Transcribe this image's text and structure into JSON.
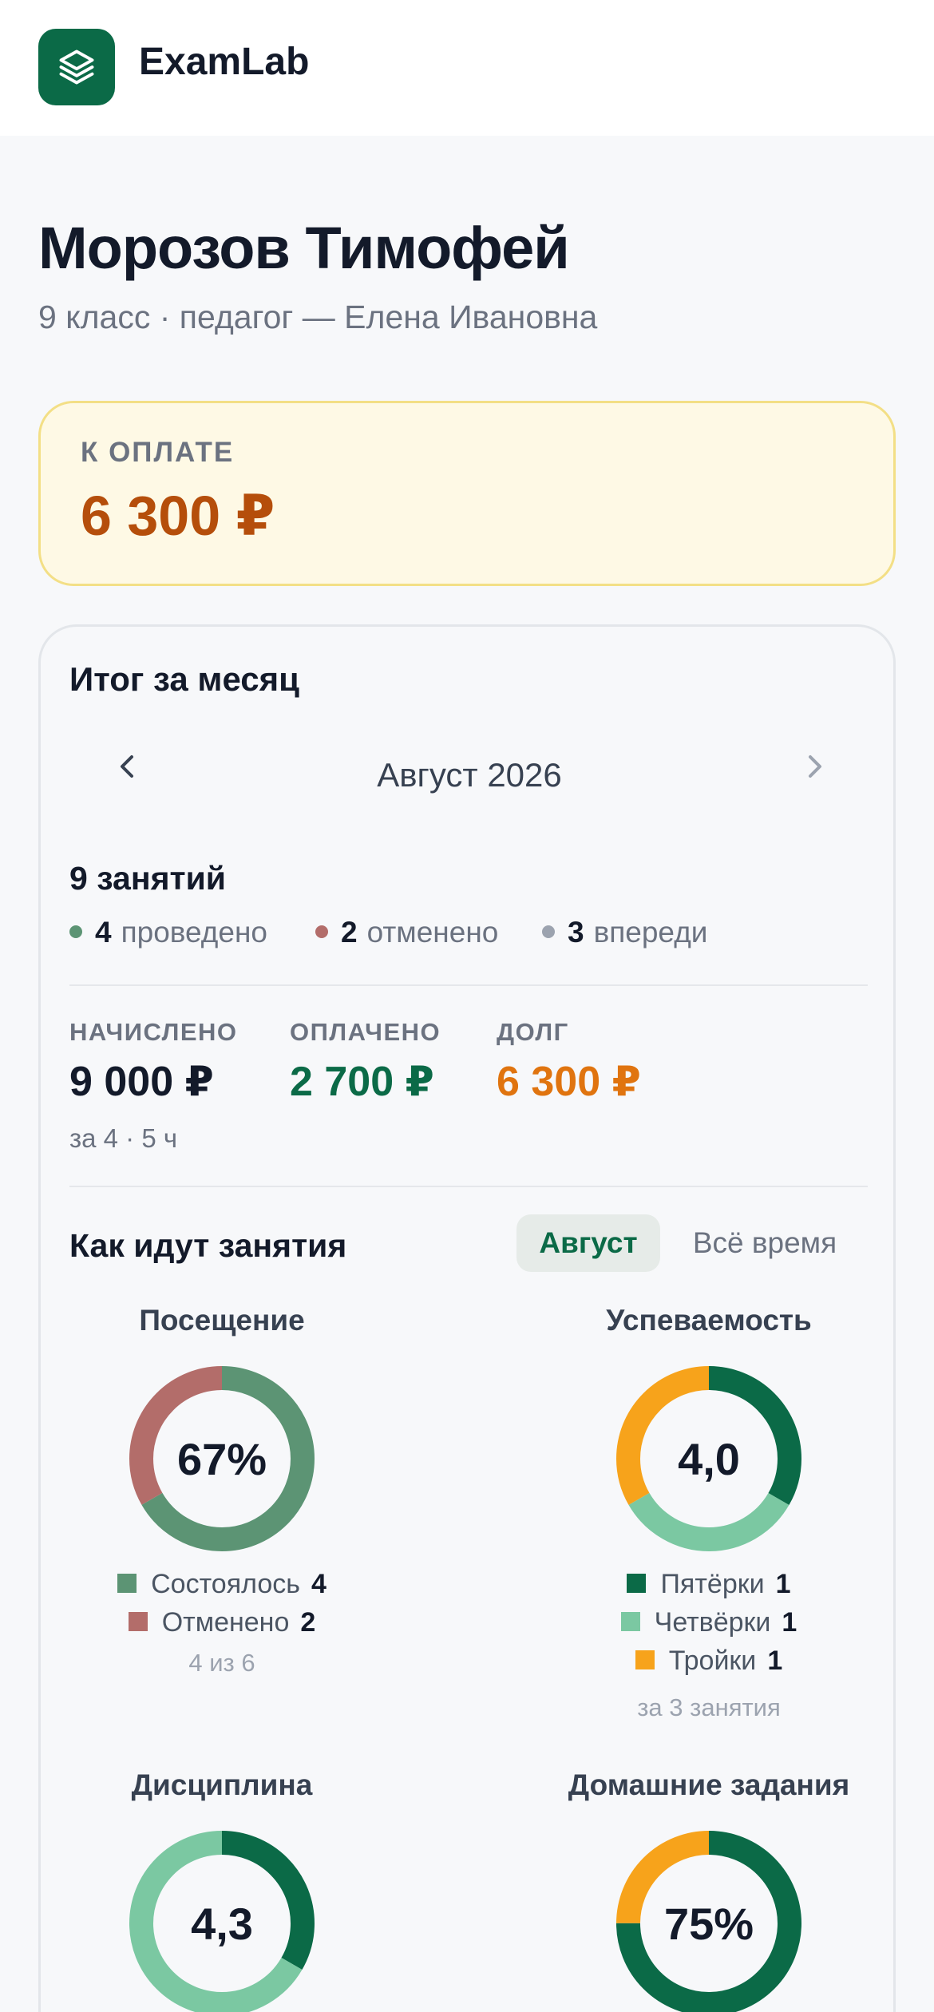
{
  "app": {
    "name": "ExamLab",
    "logo_icon": "layers-icon",
    "accent": "#0b6a47"
  },
  "student": {
    "name": "Морозов Тимофей",
    "subtitle": "9 класс · педагог — Елена Ивановна"
  },
  "due": {
    "label": "К ОПЛАТЕ",
    "amount": "6 300 ₽"
  },
  "month_card": {
    "title": "Итог за месяц",
    "month": "Август 2026",
    "lessons_total": "9 занятий",
    "stats": [
      {
        "count": "4",
        "label": "проведено",
        "color": "#5c9474"
      },
      {
        "count": "2",
        "label": "отменено",
        "color": "#b36d6a"
      },
      {
        "count": "3",
        "label": "впереди",
        "color": "#9ca3af"
      }
    ],
    "finance": {
      "accrued": {
        "label": "НАЧИСЛЕНО",
        "value": "9 000 ₽",
        "color": "#131a2a"
      },
      "paid": {
        "label": "ОПЛАЧЕНО",
        "value": "2 700 ₽",
        "color": "#0b6a47"
      },
      "debt": {
        "label": "ДОЛГ",
        "value": "6 300 ₽",
        "color": "#e0740f"
      },
      "note": "за 4 · 5 ч"
    }
  },
  "performance": {
    "title": "Как идут занятия",
    "tabs": {
      "active": "Август",
      "inactive": "Всё время"
    },
    "attendance": {
      "title": "Посещение",
      "center": "67%",
      "legend": [
        {
          "label": "Состоялось",
          "count": 4,
          "color": "#5c9474"
        },
        {
          "label": "Отменено",
          "count": 2,
          "color": "#b36d6a"
        }
      ],
      "footnote": "4 из 6"
    },
    "grades": {
      "title": "Успеваемость",
      "center": "4,0",
      "legend": [
        {
          "label": "Пятёрки",
          "count": 1,
          "color": "#0b6a47"
        },
        {
          "label": "Четвёрки",
          "count": 1,
          "color": "#7bc8a2"
        },
        {
          "label": "Тройки",
          "count": 1,
          "color": "#f7a31b"
        }
      ],
      "footnote": "за 3 занятия"
    },
    "discipline": {
      "title": "Дисциплина",
      "center": "4,3",
      "segments": [
        {
          "fraction": 0.3333,
          "color": "#0b6a47"
        },
        {
          "fraction": 0.6667,
          "color": "#7bc8a2"
        }
      ]
    },
    "homework": {
      "title": "Домашние задания",
      "center": "75%",
      "segments": [
        {
          "fraction": 0.75,
          "color": "#0b6a47"
        },
        {
          "fraction": 0.25,
          "color": "#f7a31b"
        }
      ]
    }
  }
}
